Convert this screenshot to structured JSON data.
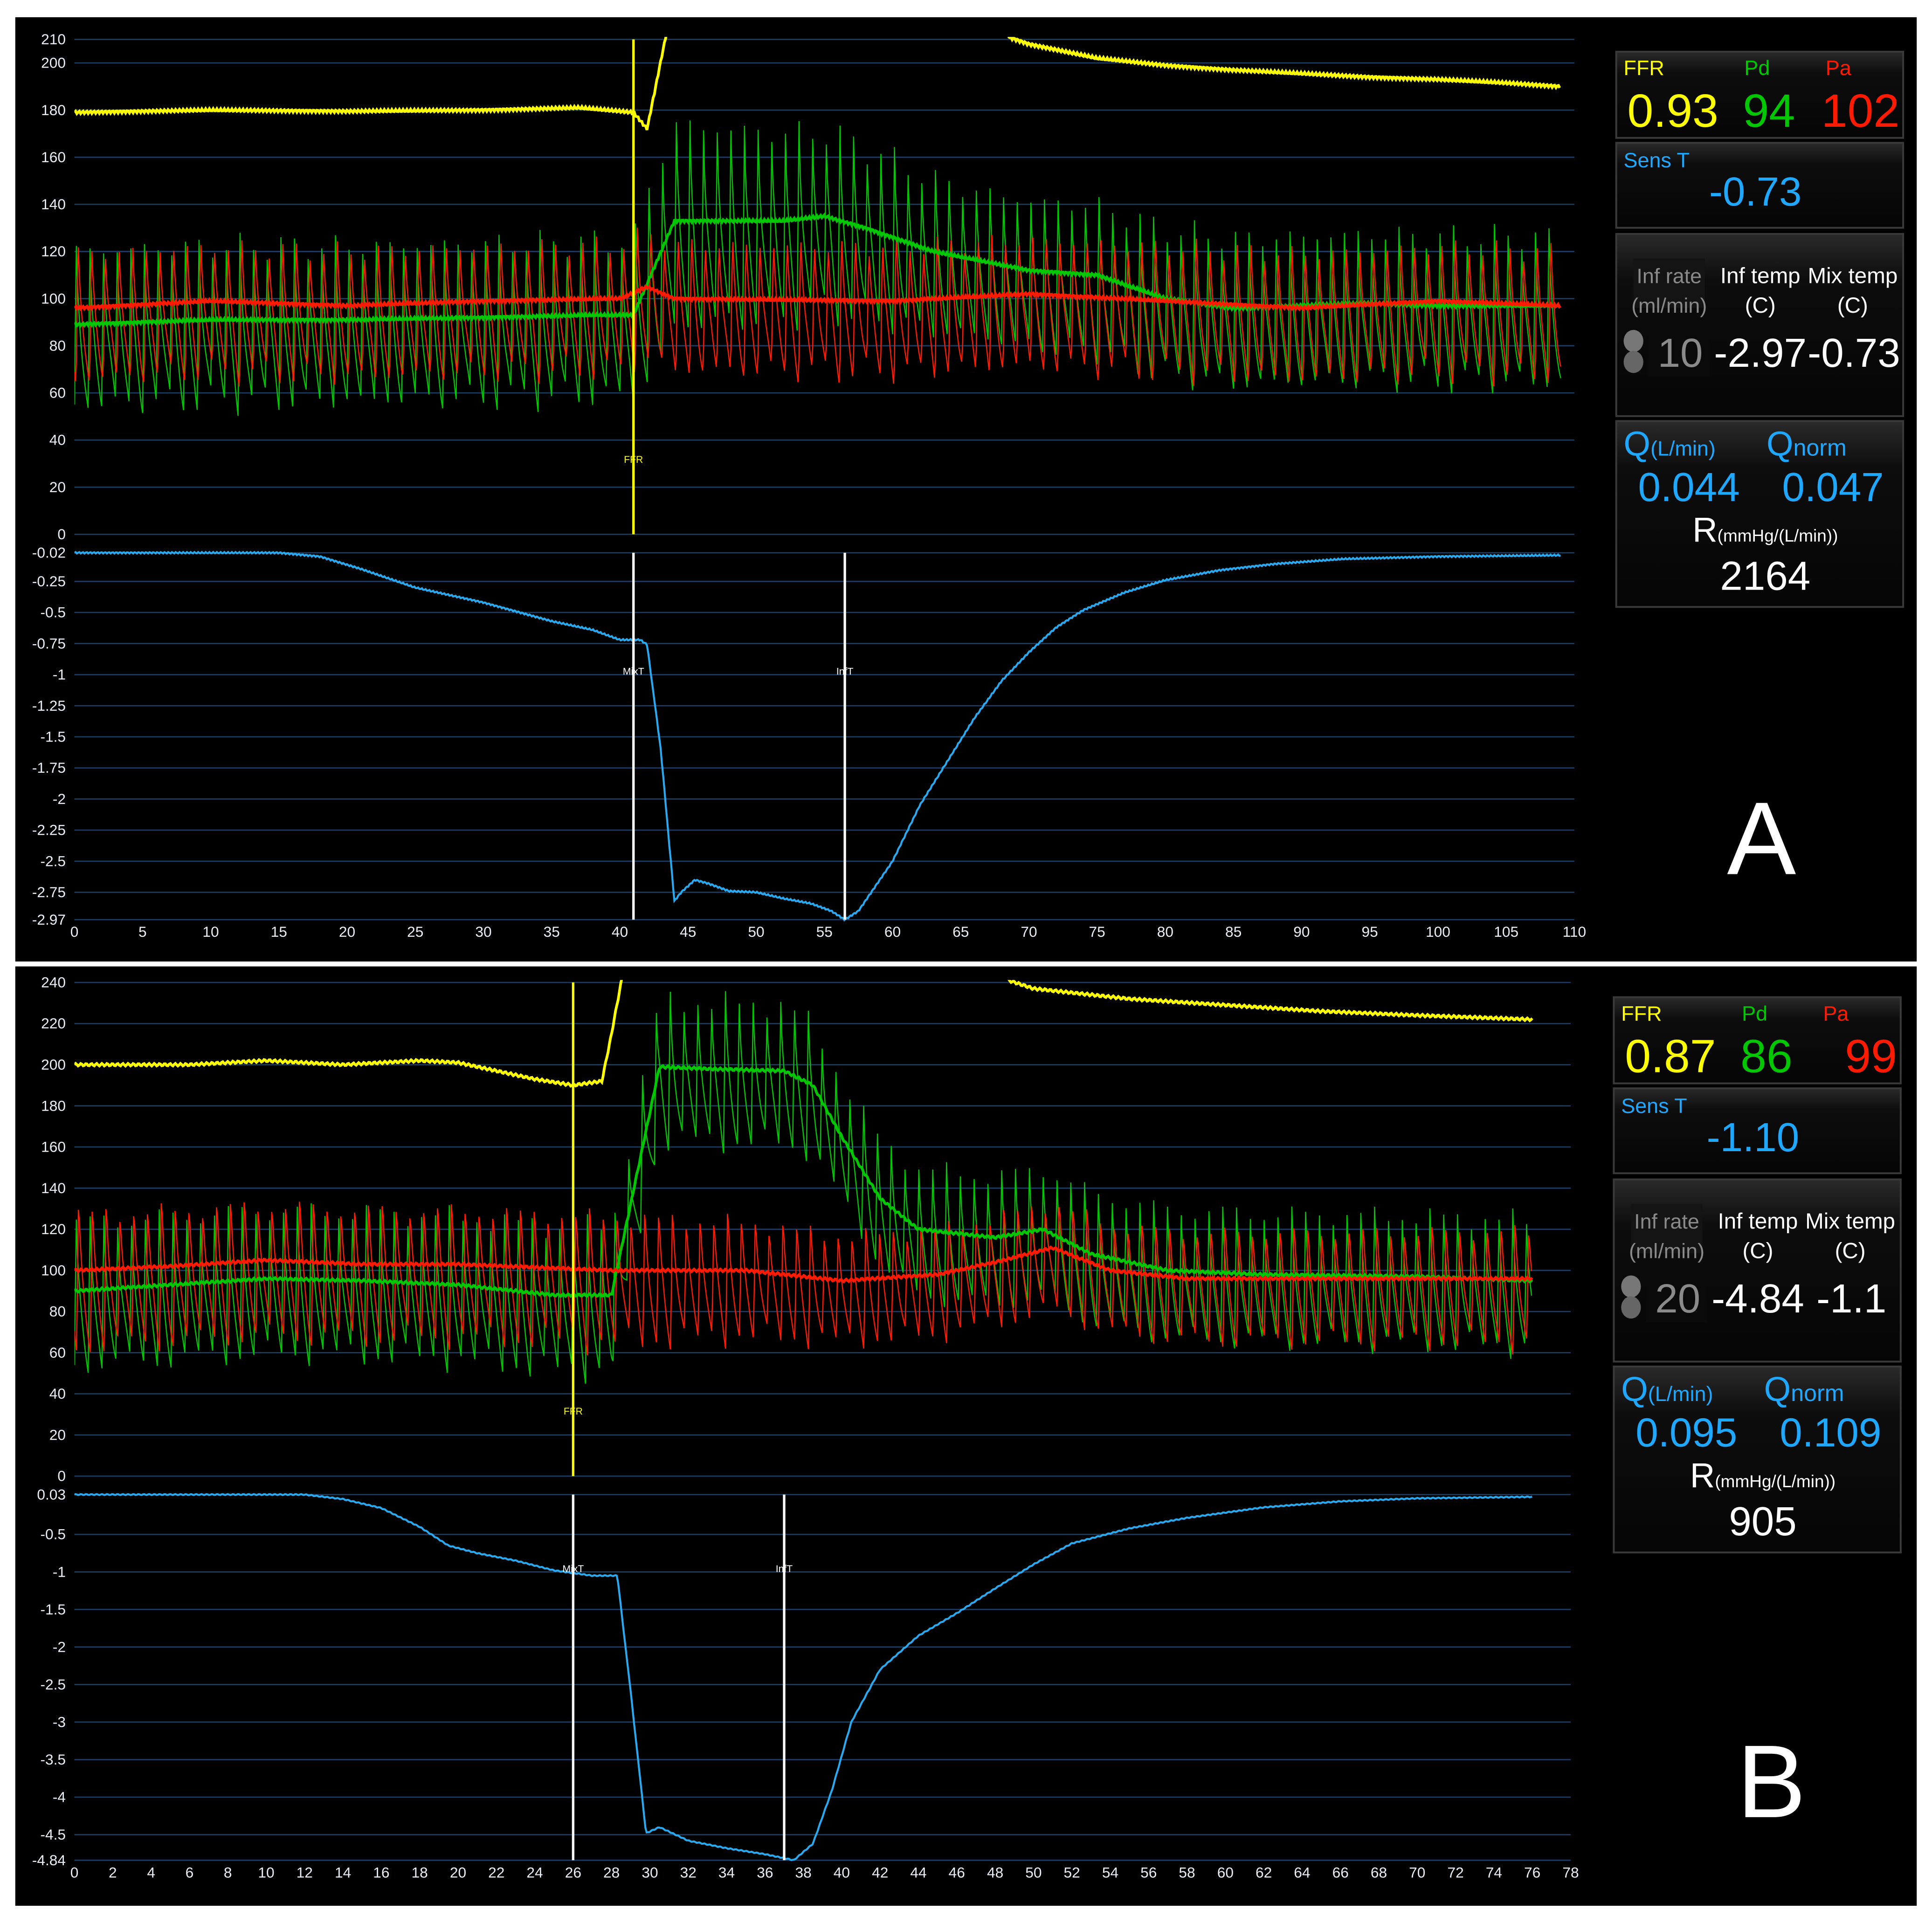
{
  "colors": {
    "ffr": "#ffff00",
    "pd": "#00c800",
    "pa": "#ff1a00",
    "temp": "#29a9f0",
    "grid": "#1c3d66",
    "marker_white": "#ffffff",
    "marker_yellow": "#ffee00",
    "readout_blue": "#1ea8ff",
    "gray": "#8a8a8a"
  },
  "panels": [
    {
      "letter": "A",
      "readout": {
        "ffr_label": "FFR",
        "ffr": "0.93",
        "pd_label": "Pd",
        "pd": "94",
        "pa_label": "Pa",
        "pa": "102",
        "sens_label": "Sens T",
        "sens": "-0.73",
        "inf_rate_label": "Inf rate",
        "inf_rate_unit": "(ml/min)",
        "inf_rate": "10",
        "inf_temp_label": "Inf temp",
        "inf_temp_unit": "(C)",
        "inf_temp": "-2.97",
        "mix_temp_label": "Mix temp",
        "mix_temp_unit": "(C)",
        "mix_temp": "-0.73",
        "q_label": "Q",
        "q_unit": "(L/min)",
        "q": "0.044",
        "qnorm_label": "Q",
        "qnorm_sub": "norm",
        "qnorm": "0.047",
        "r_label": "R",
        "r_unit": "(mmHg/(L/min))",
        "r": "2164"
      }
    },
    {
      "letter": "B",
      "readout": {
        "ffr_label": "FFR",
        "ffr": "0.87",
        "pd_label": "Pd",
        "pd": "86",
        "pa_label": "Pa",
        "pa": "99",
        "sens_label": "Sens T",
        "sens": "-1.10",
        "inf_rate_label": "Inf rate",
        "inf_rate_unit": "(ml/min)",
        "inf_rate": "20",
        "inf_temp_label": "Inf temp",
        "inf_temp_unit": "(C)",
        "inf_temp": "-4.84",
        "mix_temp_label": "Mix temp",
        "mix_temp_unit": "(C)",
        "mix_temp": "-1.1",
        "q_label": "Q",
        "q_unit": "(L/min)",
        "q": "0.095",
        "qnorm_label": "Q",
        "qnorm_sub": "norm",
        "qnorm": "0.109",
        "r_label": "R",
        "r_unit": "(mmHg/(L/min))",
        "r": "905"
      }
    }
  ],
  "chart_data": [
    {
      "id": "A-pressure",
      "type": "line",
      "xlim": [
        0,
        110
      ],
      "ylim": [
        0,
        210
      ],
      "yticks": [
        210,
        200,
        180,
        160,
        140,
        120,
        100,
        80,
        60,
        40,
        20,
        0
      ],
      "grid": true,
      "beat_period_s": 1.0,
      "markers": [
        {
          "label": "FFR",
          "x": 41,
          "color": "ffr"
        }
      ],
      "series": [
        {
          "name": "Aortic trace (yellow)",
          "color": "ffr",
          "points": [
            [
              0,
              179
            ],
            [
              10,
              180
            ],
            [
              20,
              179.5
            ],
            [
              30,
              180
            ],
            [
              37,
              181
            ],
            [
              41,
              179
            ],
            [
              42,
              172
            ],
            [
              43.5,
              215
            ]
          ],
          "points2": [
            [
              68.5,
              211
            ],
            [
              70,
              208
            ],
            [
              75,
              202
            ],
            [
              80,
              199
            ],
            [
              85,
              197
            ],
            [
              95,
              194
            ],
            [
              100,
              193
            ],
            [
              105,
              191.5
            ],
            [
              109,
              190
            ]
          ]
        },
        {
          "name": "Pd mean",
          "color": "pd",
          "points": [
            [
              0,
              89
            ],
            [
              10,
              91
            ],
            [
              20,
              91
            ],
            [
              30,
              92
            ],
            [
              38,
              93
            ],
            [
              41,
              93
            ],
            [
              44,
              133
            ],
            [
              52,
              133
            ],
            [
              55,
              135
            ],
            [
              58,
              130
            ],
            [
              63,
              120
            ],
            [
              70,
              112
            ],
            [
              75,
              110
            ],
            [
              80,
              100
            ],
            [
              85,
              96
            ],
            [
              95,
              98
            ],
            [
              100,
              97
            ],
            [
              109,
              97
            ]
          ]
        },
        {
          "name": "Pa mean",
          "color": "pa",
          "points": [
            [
              0,
              96
            ],
            [
              10,
              99
            ],
            [
              20,
              97
            ],
            [
              30,
              99
            ],
            [
              40,
              100
            ],
            [
              42,
              105
            ],
            [
              44,
              100
            ],
            [
              60,
              99
            ],
            [
              70,
              102
            ],
            [
              80,
              99
            ],
            [
              90,
              96
            ],
            [
              100,
              99
            ],
            [
              109,
              97
            ]
          ]
        },
        {
          "name": "Pd phasic",
          "color": "pd",
          "pulsatile_of": "Pd mean",
          "amplitude": [
            [
              0,
              34
            ],
            [
              41,
              34
            ],
            [
              42.5,
              45
            ],
            [
              57,
              38
            ],
            [
              65,
              32
            ],
            [
              109,
              32
            ]
          ],
          "range": [
            0,
            109
          ]
        },
        {
          "name": "Pa phasic",
          "color": "pa",
          "pulsatile_of": "Pa mean",
          "amplitude": [
            [
              0,
              32
            ],
            [
              109,
              32
            ]
          ],
          "range": [
            0,
            109
          ]
        }
      ]
    },
    {
      "id": "A-temperature",
      "type": "line",
      "xlim": [
        0,
        110
      ],
      "ylim": [
        -2.97,
        -0.02
      ],
      "xticks": [
        0,
        5,
        10,
        15,
        20,
        25,
        30,
        35,
        40,
        45,
        50,
        55,
        60,
        65,
        70,
        75,
        80,
        85,
        90,
        95,
        100,
        105,
        110
      ],
      "yticks": [
        "-0.02",
        "-0.25",
        "-0.5",
        "-0.75",
        "-1",
        "-1.25",
        "-1.5",
        "-1.75",
        "-2",
        "-2.25",
        "-2.5",
        "-2.75",
        "-2.97"
      ],
      "grid": true,
      "markers": [
        {
          "label": "MixT",
          "x": 41,
          "color": "marker_white"
        },
        {
          "label": "InfT",
          "x": 56.5,
          "color": "marker_white"
        }
      ],
      "series": [
        {
          "name": "Temperature",
          "color": "temp",
          "points": [
            [
              0,
              -0.02
            ],
            [
              15,
              -0.02
            ],
            [
              18,
              -0.05
            ],
            [
              21,
              -0.15
            ],
            [
              25,
              -0.3
            ],
            [
              30,
              -0.42
            ],
            [
              35,
              -0.57
            ],
            [
              38,
              -0.64
            ],
            [
              40,
              -0.72
            ],
            [
              41.5,
              -0.72
            ],
            [
              42,
              -0.76
            ],
            [
              43,
              -1.6
            ],
            [
              44,
              -2.82
            ],
            [
              44.5,
              -2.75
            ],
            [
              45.5,
              -2.65
            ],
            [
              46.5,
              -2.68
            ],
            [
              48,
              -2.74
            ],
            [
              50,
              -2.75
            ],
            [
              52,
              -2.8
            ],
            [
              54,
              -2.84
            ],
            [
              55.5,
              -2.9
            ],
            [
              56.5,
              -2.97
            ],
            [
              57.5,
              -2.9
            ],
            [
              60,
              -2.5
            ],
            [
              62,
              -2.05
            ],
            [
              64,
              -1.7
            ],
            [
              66,
              -1.35
            ],
            [
              68,
              -1.05
            ],
            [
              70,
              -0.82
            ],
            [
              72,
              -0.62
            ],
            [
              74,
              -0.48
            ],
            [
              77,
              -0.34
            ],
            [
              80,
              -0.24
            ],
            [
              84,
              -0.16
            ],
            [
              88,
              -0.11
            ],
            [
              93,
              -0.07
            ],
            [
              100,
              -0.05
            ],
            [
              109,
              -0.04
            ]
          ]
        }
      ]
    },
    {
      "id": "B-pressure",
      "type": "line",
      "xlim": [
        0,
        78
      ],
      "ylim": [
        0,
        240
      ],
      "yticks": [
        240,
        220,
        200,
        180,
        160,
        140,
        120,
        100,
        80,
        60,
        40,
        20,
        0
      ],
      "grid": true,
      "beat_period_s": 0.72,
      "markers": [
        {
          "label": "FFR",
          "x": 26,
          "color": "ffr"
        }
      ],
      "series": [
        {
          "name": "Aortic trace (yellow)",
          "color": "ffr",
          "points": [
            [
              0,
              200
            ],
            [
              6,
              200
            ],
            [
              10,
              202
            ],
            [
              14,
              200
            ],
            [
              18,
              202
            ],
            [
              20,
              201
            ],
            [
              22,
              197
            ],
            [
              24,
              193
            ],
            [
              26,
              190
            ],
            [
              27.5,
              192
            ],
            [
              28,
              215
            ],
            [
              28.6,
              245
            ]
          ],
          "points2": [
            [
              48.7,
              241
            ],
            [
              50,
              237
            ],
            [
              55,
              232
            ],
            [
              60,
              229
            ],
            [
              65,
              226
            ],
            [
              70,
              224
            ],
            [
              76,
              222
            ]
          ]
        },
        {
          "name": "Pd mean",
          "color": "pd",
          "points": [
            [
              0,
              90
            ],
            [
              5,
              93
            ],
            [
              10,
              96
            ],
            [
              15,
              95
            ],
            [
              20,
              93
            ],
            [
              25,
              88
            ],
            [
              28,
              88
            ],
            [
              30.5,
              199
            ],
            [
              33,
              198
            ],
            [
              37,
              197
            ],
            [
              38.5,
              190
            ],
            [
              40,
              165
            ],
            [
              42,
              135
            ],
            [
              44,
              120
            ],
            [
              48,
              116
            ],
            [
              50.5,
              120
            ],
            [
              53,
              108
            ],
            [
              57,
              100
            ],
            [
              62,
              98
            ],
            [
              70,
              97
            ],
            [
              76,
              95
            ]
          ]
        },
        {
          "name": "Pa mean",
          "color": "pa",
          "points": [
            [
              0,
              100
            ],
            [
              5,
              102
            ],
            [
              10,
              105
            ],
            [
              15,
              103
            ],
            [
              20,
              103
            ],
            [
              28,
              100
            ],
            [
              35,
              100
            ],
            [
              40,
              95
            ],
            [
              45,
              98
            ],
            [
              48,
              104
            ],
            [
              51,
              111
            ],
            [
              54,
              100
            ],
            [
              58,
              96
            ],
            [
              65,
              96
            ],
            [
              76,
              96
            ]
          ]
        },
        {
          "name": "Pd phasic",
          "color": "pd",
          "pulsatile_of": "Pd mean",
          "amplitude": [
            [
              0,
              36
            ],
            [
              27,
              36
            ],
            [
              28.5,
              35
            ],
            [
              37,
              35
            ],
            [
              40,
              30
            ],
            [
              44,
              32
            ],
            [
              76,
              32
            ]
          ],
          "range": [
            0,
            76
          ]
        },
        {
          "name": "Pa phasic",
          "color": "pa",
          "pulsatile_of": "Pa mean",
          "amplitude": [
            [
              0,
              38
            ],
            [
              28,
              36
            ],
            [
              40,
              30
            ],
            [
              76,
              32
            ]
          ],
          "range": [
            0,
            76
          ]
        }
      ]
    },
    {
      "id": "B-temperature",
      "type": "line",
      "xlim": [
        0,
        78
      ],
      "ylim": [
        -4.84,
        0.03
      ],
      "xticks": [
        0,
        2,
        4,
        6,
        8,
        10,
        12,
        14,
        16,
        18,
        20,
        22,
        24,
        26,
        28,
        30,
        32,
        34,
        36,
        38,
        40,
        42,
        44,
        46,
        48,
        50,
        52,
        54,
        56,
        58,
        60,
        62,
        64,
        66,
        68,
        70,
        72,
        74,
        76,
        78
      ],
      "yticks": [
        "0.03",
        "-0.5",
        "-1",
        "-1.5",
        "-2",
        "-2.5",
        "-3",
        "-3.5",
        "-4",
        "-4.5",
        "-4.84"
      ],
      "grid": true,
      "markers": [
        {
          "label": "MixT",
          "x": 26,
          "color": "marker_white"
        },
        {
          "label": "InfT",
          "x": 37,
          "color": "marker_white"
        }
      ],
      "series": [
        {
          "name": "Temperature",
          "color": "temp",
          "points": [
            [
              0,
              0.03
            ],
            [
              12,
              0.03
            ],
            [
              14,
              -0.03
            ],
            [
              16,
              -0.15
            ],
            [
              18,
              -0.4
            ],
            [
              19.5,
              -0.65
            ],
            [
              21,
              -0.75
            ],
            [
              23,
              -0.85
            ],
            [
              25,
              -0.98
            ],
            [
              27,
              -1.05
            ],
            [
              28.3,
              -1.05
            ],
            [
              29,
              -2.6
            ],
            [
              29.8,
              -4.48
            ],
            [
              30.5,
              -4.4
            ],
            [
              32,
              -4.58
            ],
            [
              34,
              -4.68
            ],
            [
              36,
              -4.76
            ],
            [
              37.5,
              -4.84
            ],
            [
              38.5,
              -4.62
            ],
            [
              39.5,
              -3.9
            ],
            [
              40.5,
              -3.0
            ],
            [
              42,
              -2.3
            ],
            [
              44,
              -1.85
            ],
            [
              46,
              -1.55
            ],
            [
              48,
              -1.22
            ],
            [
              50,
              -0.9
            ],
            [
              52,
              -0.62
            ],
            [
              55,
              -0.42
            ],
            [
              58,
              -0.28
            ],
            [
              62,
              -0.14
            ],
            [
              66,
              -0.06
            ],
            [
              70,
              -0.02
            ],
            [
              76,
              0.0
            ]
          ]
        }
      ]
    }
  ]
}
